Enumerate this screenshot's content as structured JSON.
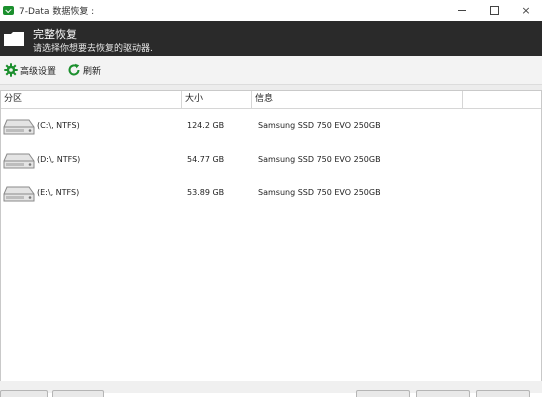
{
  "window": {
    "title": "7-Data 数据恢复 :",
    "controls": {
      "minimize": "minimize",
      "maximize": "maximize",
      "close": "×"
    }
  },
  "header": {
    "icon": "folder-icon",
    "title": "完整恢复",
    "subtitle": "请选择你想要去恢复的驱动器."
  },
  "toolbar": {
    "settings_label": "高级设置",
    "settings_icon": "gear-icon",
    "refresh_label": "刷新",
    "refresh_icon": "refresh-icon",
    "icon_color": "#1b8f2d"
  },
  "list": {
    "columns": [
      "分区",
      "大小",
      "信息",
      ""
    ],
    "rows": [
      {
        "partition": "(C:\\, NTFS)",
        "size": "124.2 GB",
        "info": "Samsung SSD 750 EVO 250GB"
      },
      {
        "partition": "(D:\\, NTFS)",
        "size": "54.77 GB",
        "info": "Samsung SSD 750 EVO 250GB"
      },
      {
        "partition": "(E:\\, NTFS)",
        "size": "53.89 GB",
        "info": "Samsung SSD 750 EVO 250GB"
      }
    ]
  }
}
